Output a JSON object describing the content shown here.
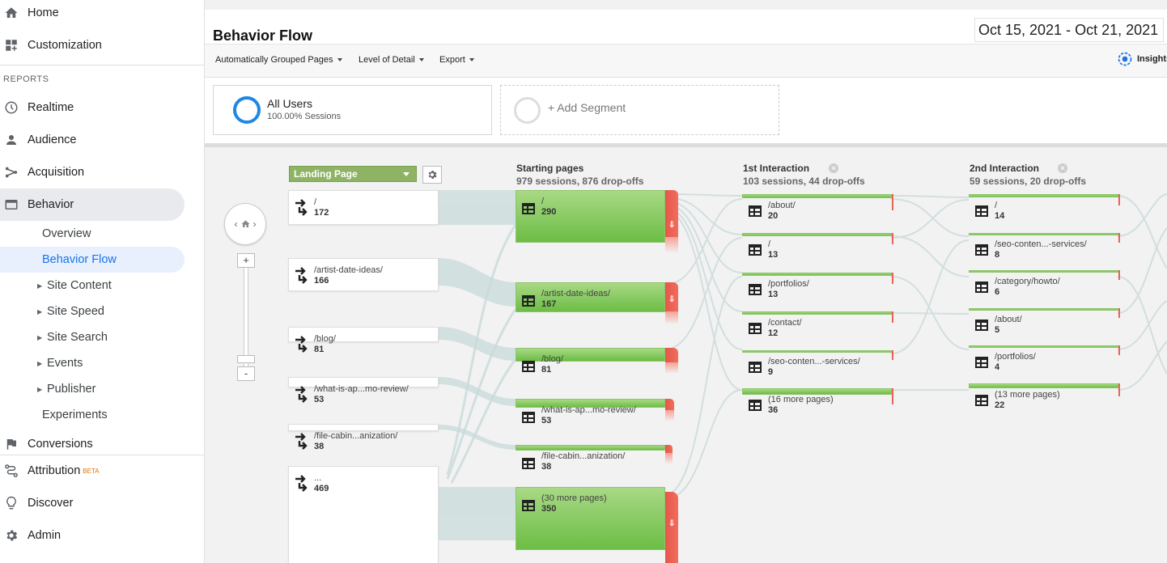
{
  "sidebar": {
    "home": "Home",
    "customization": "Customization",
    "reports_label": "REPORTS",
    "realtime": "Realtime",
    "audience": "Audience",
    "acquisition": "Acquisition",
    "behavior": "Behavior",
    "behavior_items": {
      "overview": "Overview",
      "behavior_flow": "Behavior Flow",
      "site_content": "Site Content",
      "site_speed": "Site Speed",
      "site_search": "Site Search",
      "events": "Events",
      "publisher": "Publisher",
      "experiments": "Experiments"
    },
    "conversions": "Conversions",
    "attribution": "Attribution",
    "attribution_badge": "BETA",
    "discover": "Discover",
    "admin": "Admin"
  },
  "header": {
    "title": "Behavior Flow",
    "date_range": "Oct 15, 2021 - Oct 21, 2021"
  },
  "toolbar": {
    "grouped_pages": "Automatically Grouped Pages",
    "level_of_detail": "Level of Detail",
    "export": "Export",
    "insights": "Insights"
  },
  "segments": {
    "all_users": {
      "name": "All Users",
      "sub": "100.00% Sessions"
    },
    "add": "+ Add Segment"
  },
  "flow": {
    "dimension": "Landing Page",
    "columns": {
      "starting": {
        "title": "Starting pages",
        "stats": "979 sessions, 876 drop-offs"
      },
      "first": {
        "title": "1st Interaction",
        "stats": "103 sessions, 44 drop-offs"
      },
      "second": {
        "title": "2nd Interaction",
        "stats": "59 sessions, 20 drop-offs"
      }
    },
    "landing": [
      {
        "label": "/",
        "value": "172"
      },
      {
        "label": "/artist-date-ideas/",
        "value": "166"
      },
      {
        "label": "/blog/",
        "value": "81"
      },
      {
        "label": "/what-is-ap...mo-review/",
        "value": "53"
      },
      {
        "label": "/file-cabin...anization/",
        "value": "38"
      },
      {
        "label": "...",
        "value": "469"
      }
    ],
    "starting": [
      {
        "label": "/",
        "value": "290"
      },
      {
        "label": "/artist-date-ideas/",
        "value": "167"
      },
      {
        "label": "/blog/",
        "value": "81"
      },
      {
        "label": "/what-is-ap...mo-review/",
        "value": "53"
      },
      {
        "label": "/file-cabin...anization/",
        "value": "38"
      },
      {
        "label": "(30 more pages)",
        "value": "350"
      }
    ],
    "first": [
      {
        "label": "/about/",
        "value": "20"
      },
      {
        "label": "/",
        "value": "13"
      },
      {
        "label": "/portfolios/",
        "value": "13"
      },
      {
        "label": "/contact/",
        "value": "12"
      },
      {
        "label": "/seo-conten...-services/",
        "value": "9"
      },
      {
        "label": "(16 more pages)",
        "value": "36"
      }
    ],
    "second": [
      {
        "label": "/",
        "value": "14"
      },
      {
        "label": "/seo-conten...-services/",
        "value": "8"
      },
      {
        "label": "/category/howto/",
        "value": "6"
      },
      {
        "label": "/about/",
        "value": "5"
      },
      {
        "label": "/portfolios/",
        "value": "4"
      },
      {
        "label": "(13 more pages)",
        "value": "22"
      }
    ]
  }
}
